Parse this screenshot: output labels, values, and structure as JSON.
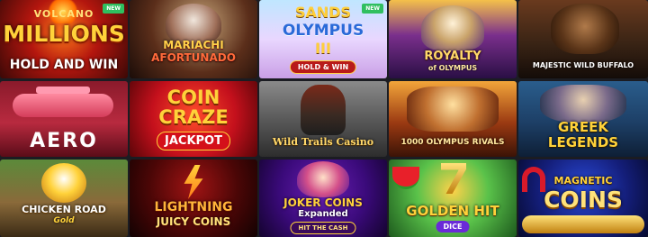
{
  "tiles": [
    {
      "id": "volcano-millions",
      "line1": "VOLCANO",
      "line2": "MILLIONS",
      "line3": "HOLD AND WIN",
      "badge": "NEW"
    },
    {
      "id": "mariachi-afortunado",
      "line1": "MARIACHI",
      "line2": "AFORTUNADO"
    },
    {
      "id": "sands-of-olympus",
      "line1": "SANDS",
      "line2": "OLYMPUS",
      "line3": "III",
      "line4": "HOLD & WIN",
      "badge": "NEW"
    },
    {
      "id": "royalty-of-olympus",
      "line1": "ROYALTY",
      "line2": "of OLYMPUS"
    },
    {
      "id": "majestic-wild-buffalo",
      "line1": "MAJESTIC WILD BUFFALO"
    },
    {
      "id": "aero",
      "line1": "AERO"
    },
    {
      "id": "coin-craze",
      "line1": "COIN",
      "line2": "CRAZE",
      "line3": "JACKPOT"
    },
    {
      "id": "wild-trails-casino",
      "line1": "Wild Trails Casino"
    },
    {
      "id": "1000-olympus-rivals",
      "line1": "1000 OLYMPUS RIVALS"
    },
    {
      "id": "greek-legends",
      "line1": "GREEK",
      "line2": "LEGENDS"
    },
    {
      "id": "chicken-road-gold",
      "line1": "CHICKEN ROAD",
      "line2": "Gold"
    },
    {
      "id": "lightning-juicy-coins",
      "line1": "LIGHTNING",
      "line2": "JUICY COINS"
    },
    {
      "id": "joker-coins-expanded",
      "line1": "JOKER COINS",
      "line2": "Expanded",
      "line3": "HIT THE CASH"
    },
    {
      "id": "golden-hit-dice",
      "line1": "GOLDEN HIT",
      "line2": "DICE"
    },
    {
      "id": "magnetic-coins",
      "line1": "MAGNETIC",
      "line2": "COINS"
    }
  ]
}
